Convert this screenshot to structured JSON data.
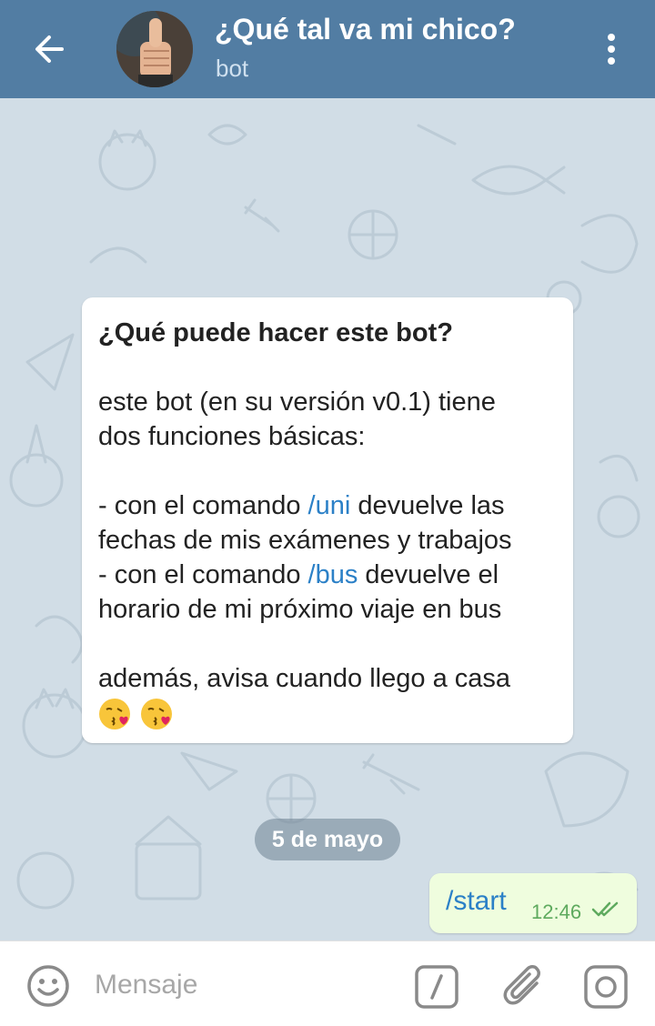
{
  "header": {
    "title": "¿Qué tal va mi chico?",
    "subtitle": "bot"
  },
  "info": {
    "title": "¿Qué puede hacer este bot?",
    "p1_line1": "este bot (en su versión v0.1) tiene",
    "p1_line2": "dos funciones básicas:",
    "line3_pre": "- con el comando ",
    "line3_cmd": "/uni",
    "line3_post": " devuelve las",
    "line4": "fechas de mis exámenes y trabajos",
    "line5_pre": "- con el comando ",
    "line5_cmd": "/bus",
    "line5_post": " devuelve el",
    "line6": "horario de mi próximo viaje en bus",
    "line7": "además, avisa cuando llego a casa"
  },
  "date_label": "5 de mayo",
  "outgoing": {
    "text": "/start",
    "time": "12:46"
  },
  "input": {
    "placeholder": "Mensaje"
  },
  "icons": {
    "back": "arrow-left-icon",
    "menu": "more-vertical-icon",
    "emoji": "smiley-icon",
    "commands": "slash-command-icon",
    "attach": "paperclip-icon",
    "camera": "camera-icon",
    "read": "double-check-icon"
  },
  "colors": {
    "header": "#527da3",
    "chat_bg": "#d1dde6",
    "command_link": "#2b80c7",
    "outgoing_bubble": "#effdde",
    "outgoing_time": "#5eaa5e"
  }
}
